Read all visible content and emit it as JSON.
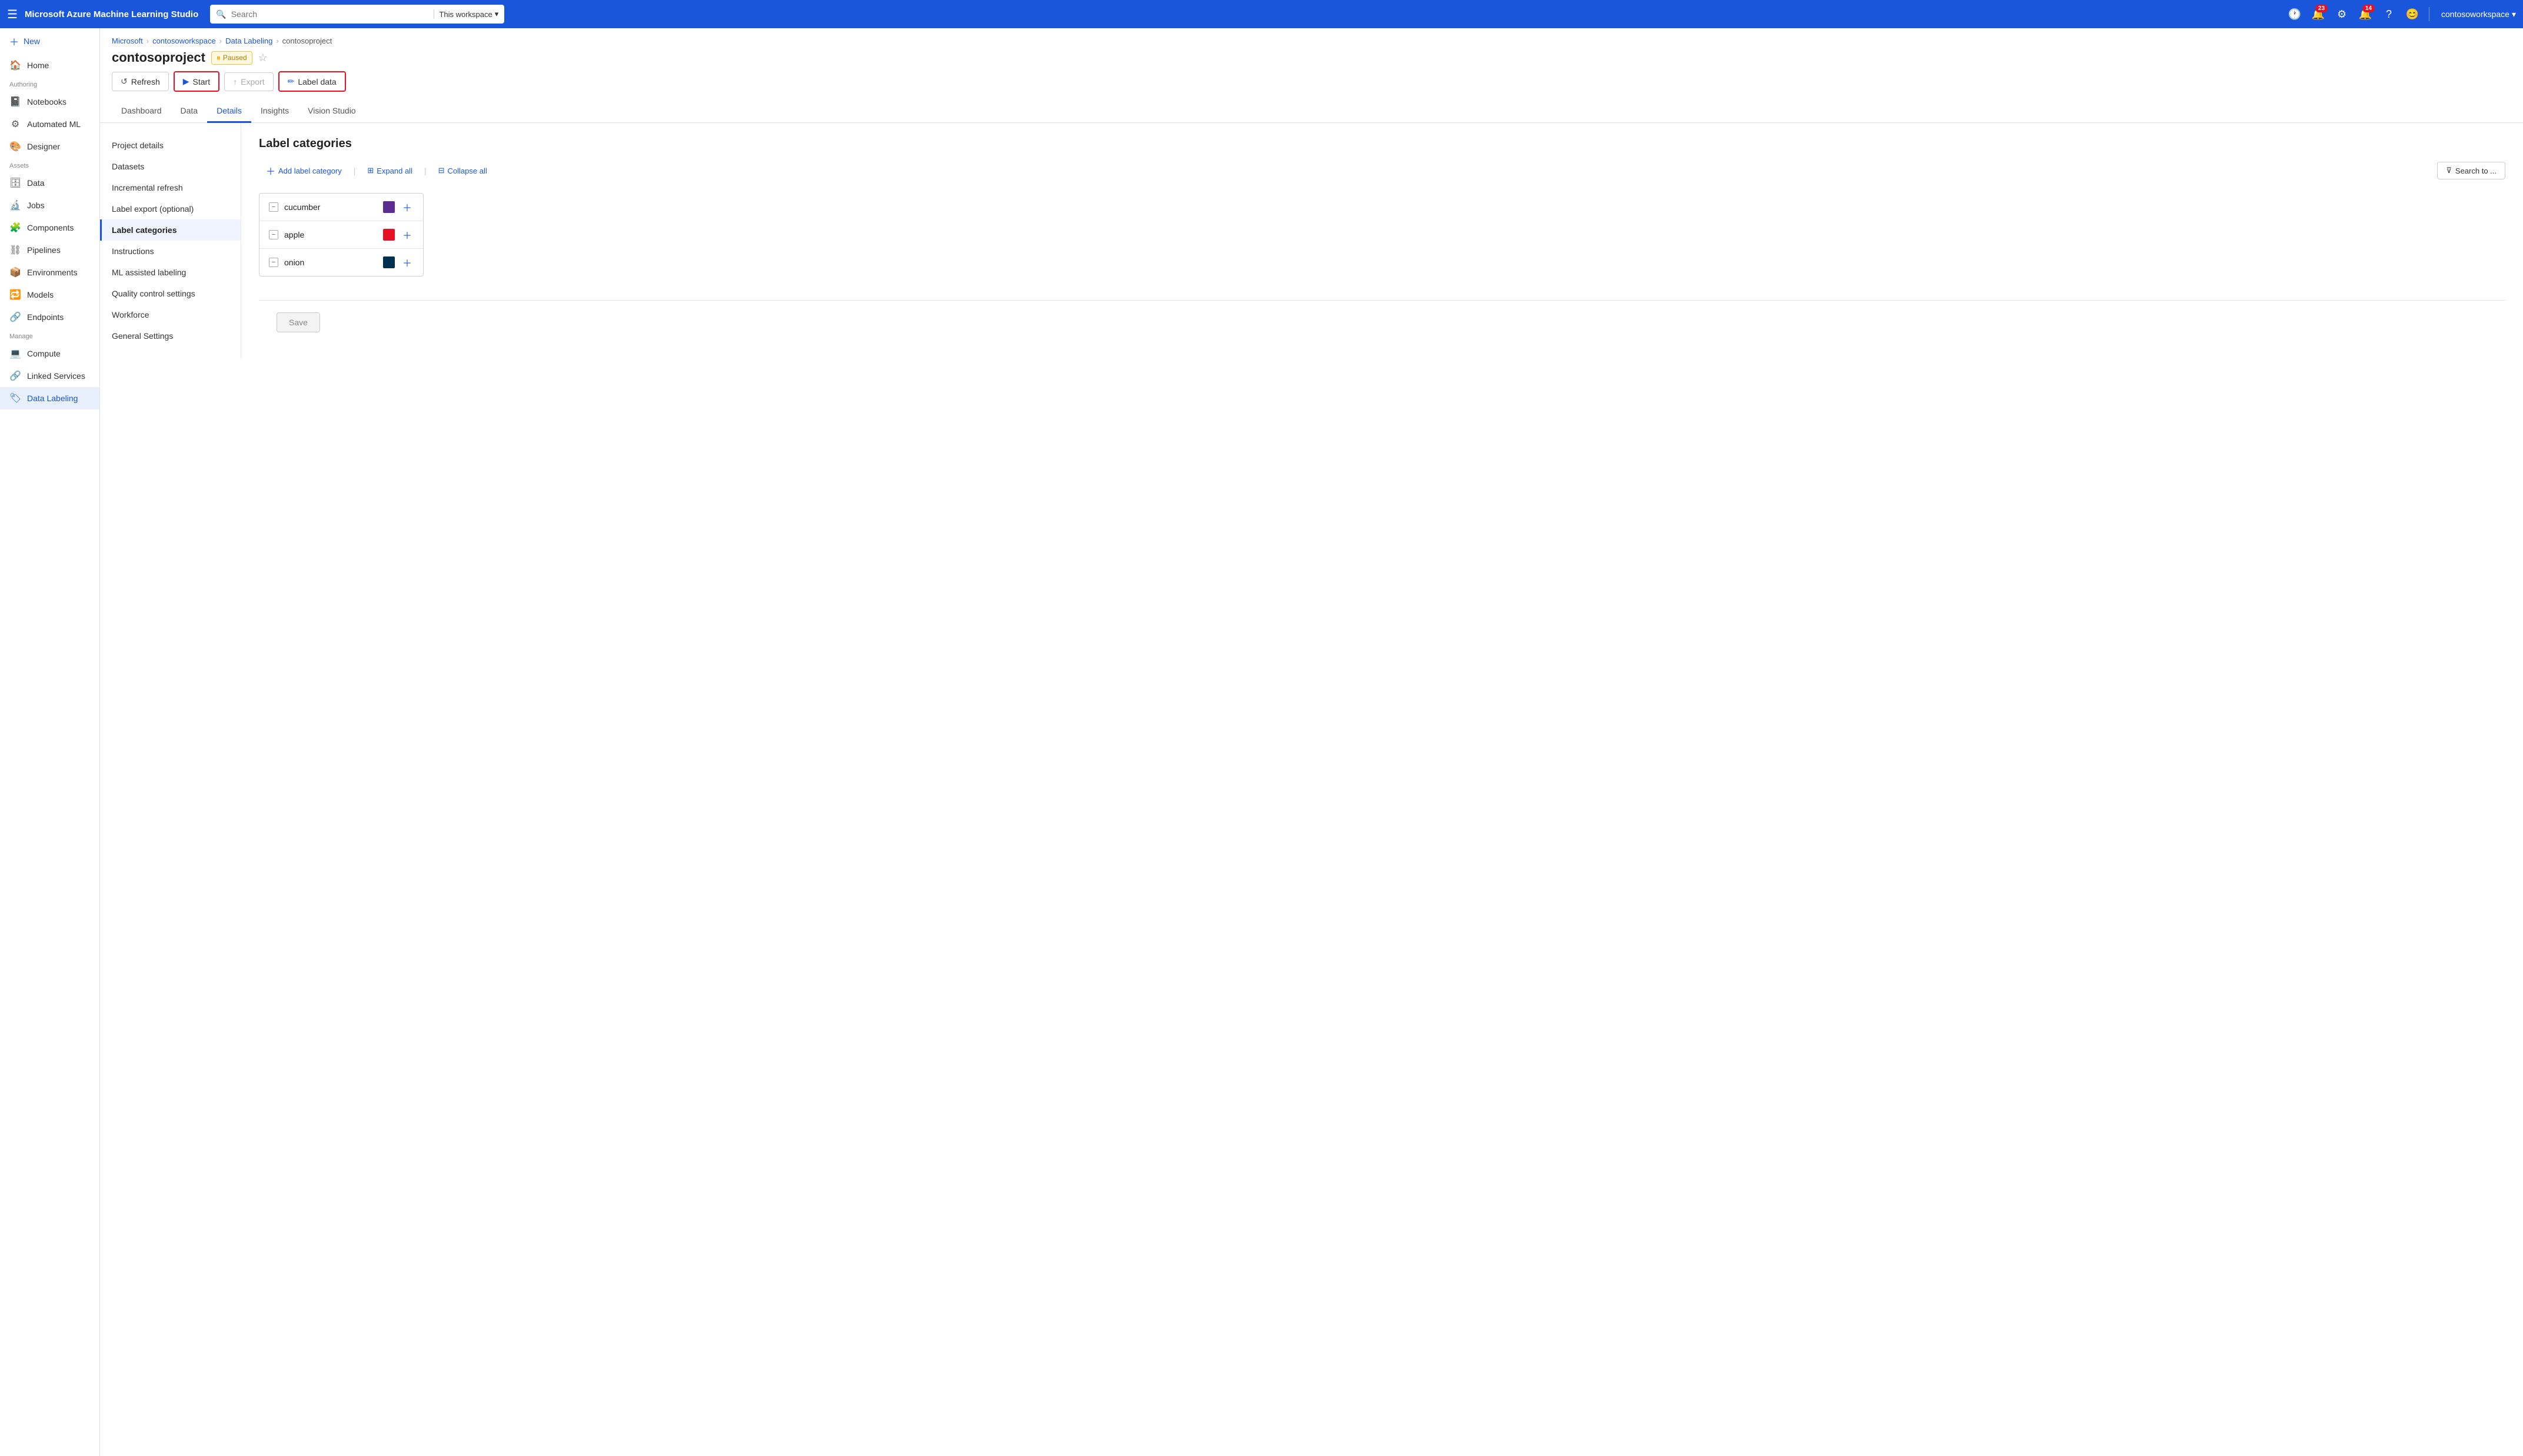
{
  "topNav": {
    "brand": "Microsoft Azure Machine Learning Studio",
    "searchPlaceholder": "Search",
    "searchScope": "This workspace",
    "notifications1": "23",
    "notifications2": "14",
    "username": "contosoworkspace"
  },
  "sidebar": {
    "menuLabel": "☰",
    "homeItem": "Microsoft",
    "newLabel": "New",
    "homeLabel": "Home",
    "authoringLabel": "Authoring",
    "items": [
      {
        "id": "notebooks",
        "label": "Notebooks",
        "icon": "📓"
      },
      {
        "id": "automated-ml",
        "label": "Automated ML",
        "icon": "⚙"
      },
      {
        "id": "designer",
        "label": "Designer",
        "icon": "🎨"
      }
    ],
    "assetsLabel": "Assets",
    "assetItems": [
      {
        "id": "data",
        "label": "Data",
        "icon": "🗄"
      },
      {
        "id": "jobs",
        "label": "Jobs",
        "icon": "🔬"
      },
      {
        "id": "components",
        "label": "Components",
        "icon": "🧩"
      },
      {
        "id": "pipelines",
        "label": "Pipelines",
        "icon": "⛓"
      },
      {
        "id": "environments",
        "label": "Environments",
        "icon": "📦"
      },
      {
        "id": "models",
        "label": "Models",
        "icon": "🔁"
      },
      {
        "id": "endpoints",
        "label": "Endpoints",
        "icon": "🔗"
      }
    ],
    "manageLabel": "Manage",
    "manageItems": [
      {
        "id": "compute",
        "label": "Compute",
        "icon": "💻"
      },
      {
        "id": "linked-services",
        "label": "Linked Services",
        "icon": "🔗"
      },
      {
        "id": "data-labeling",
        "label": "Data Labeling",
        "icon": "🏷",
        "active": true
      }
    ]
  },
  "breadcrumb": {
    "items": [
      "Microsoft",
      "contosoworkspace",
      "Data Labeling",
      "contosoproject"
    ]
  },
  "pageHeader": {
    "title": "contosoproject",
    "status": "Paused"
  },
  "toolbar": {
    "refreshLabel": "Refresh",
    "startLabel": "Start",
    "exportLabel": "Export",
    "labelDataLabel": "Label data"
  },
  "tabs": {
    "items": [
      "Dashboard",
      "Data",
      "Details",
      "Insights",
      "Vision Studio"
    ],
    "activeIndex": 2
  },
  "subNav": {
    "items": [
      {
        "id": "project-details",
        "label": "Project details"
      },
      {
        "id": "datasets",
        "label": "Datasets"
      },
      {
        "id": "incremental-refresh",
        "label": "Incremental refresh"
      },
      {
        "id": "label-export",
        "label": "Label export (optional)"
      },
      {
        "id": "label-categories",
        "label": "Label categories",
        "active": true
      },
      {
        "id": "instructions",
        "label": "Instructions"
      },
      {
        "id": "ml-assisted",
        "label": "ML assisted labeling"
      },
      {
        "id": "quality-control",
        "label": "Quality control settings"
      },
      {
        "id": "workforce",
        "label": "Workforce"
      },
      {
        "id": "general-settings",
        "label": "General Settings"
      }
    ]
  },
  "labelCategories": {
    "title": "Label categories",
    "addLabel": "Add label category",
    "expandAllLabel": "Expand all",
    "collapseAllLabel": "Collapse all",
    "searchPlaceholder": "Search to ...",
    "categories": [
      {
        "id": "cucumber",
        "name": "cucumber",
        "color": "#5c2d91"
      },
      {
        "id": "apple",
        "name": "apple",
        "color": "#e81123"
      },
      {
        "id": "onion",
        "name": "onion",
        "color": "#003153"
      }
    ]
  },
  "saveLabel": "Save"
}
